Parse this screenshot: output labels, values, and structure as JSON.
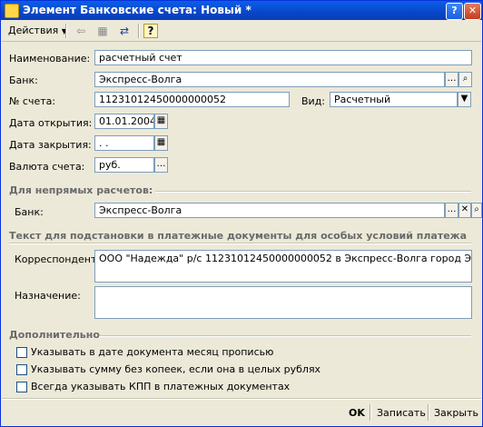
{
  "window": {
    "title": "Элемент Банковские счета: Новый *"
  },
  "toolbar": {
    "actions_label": "Действия",
    "help_label": "?"
  },
  "form": {
    "name_label": "Наименование:",
    "name_value": "расчетный счет",
    "bank_label": "Банк:",
    "bank_value": "Экспресс-Волга",
    "account_label": "№ счета:",
    "account_value": "11231012450000000052",
    "type_label": "Вид:",
    "type_value": "Расчетный",
    "open_date_label": "Дата открытия:",
    "open_date_value": "01.01.2004",
    "close_date_label": "Дата закрытия:",
    "close_date_value": " .  .",
    "currency_label": "Валюта счета:",
    "currency_value": "руб."
  },
  "indirect": {
    "section_title": "Для непрямых расчетов:",
    "bank_label": "Банк:",
    "bank_value": "Экспресс-Волга"
  },
  "substitution": {
    "section_title": "Текст для подстановки в платежные документы для особых условий платежа",
    "correspondent_label": "Корреспондент:",
    "correspondent_value": "ООО \"Надежда\" р/с 11231012450000000052 в Экспресс-Волга город Энгельс",
    "purpose_label": "Назначение:",
    "purpose_value": ""
  },
  "additional": {
    "section_title": "Дополнительно",
    "options": [
      {
        "label": "Указывать в дате документа месяц прописью",
        "checked": false
      },
      {
        "label": "Указывать сумму без копеек, если она в целых рублях",
        "checked": false
      },
      {
        "label": "Всегда указывать КПП в платежных документах",
        "checked": false
      }
    ]
  },
  "footer": {
    "ok_label": "OK",
    "save_label": "Записать",
    "close_label": "Закрыть"
  }
}
